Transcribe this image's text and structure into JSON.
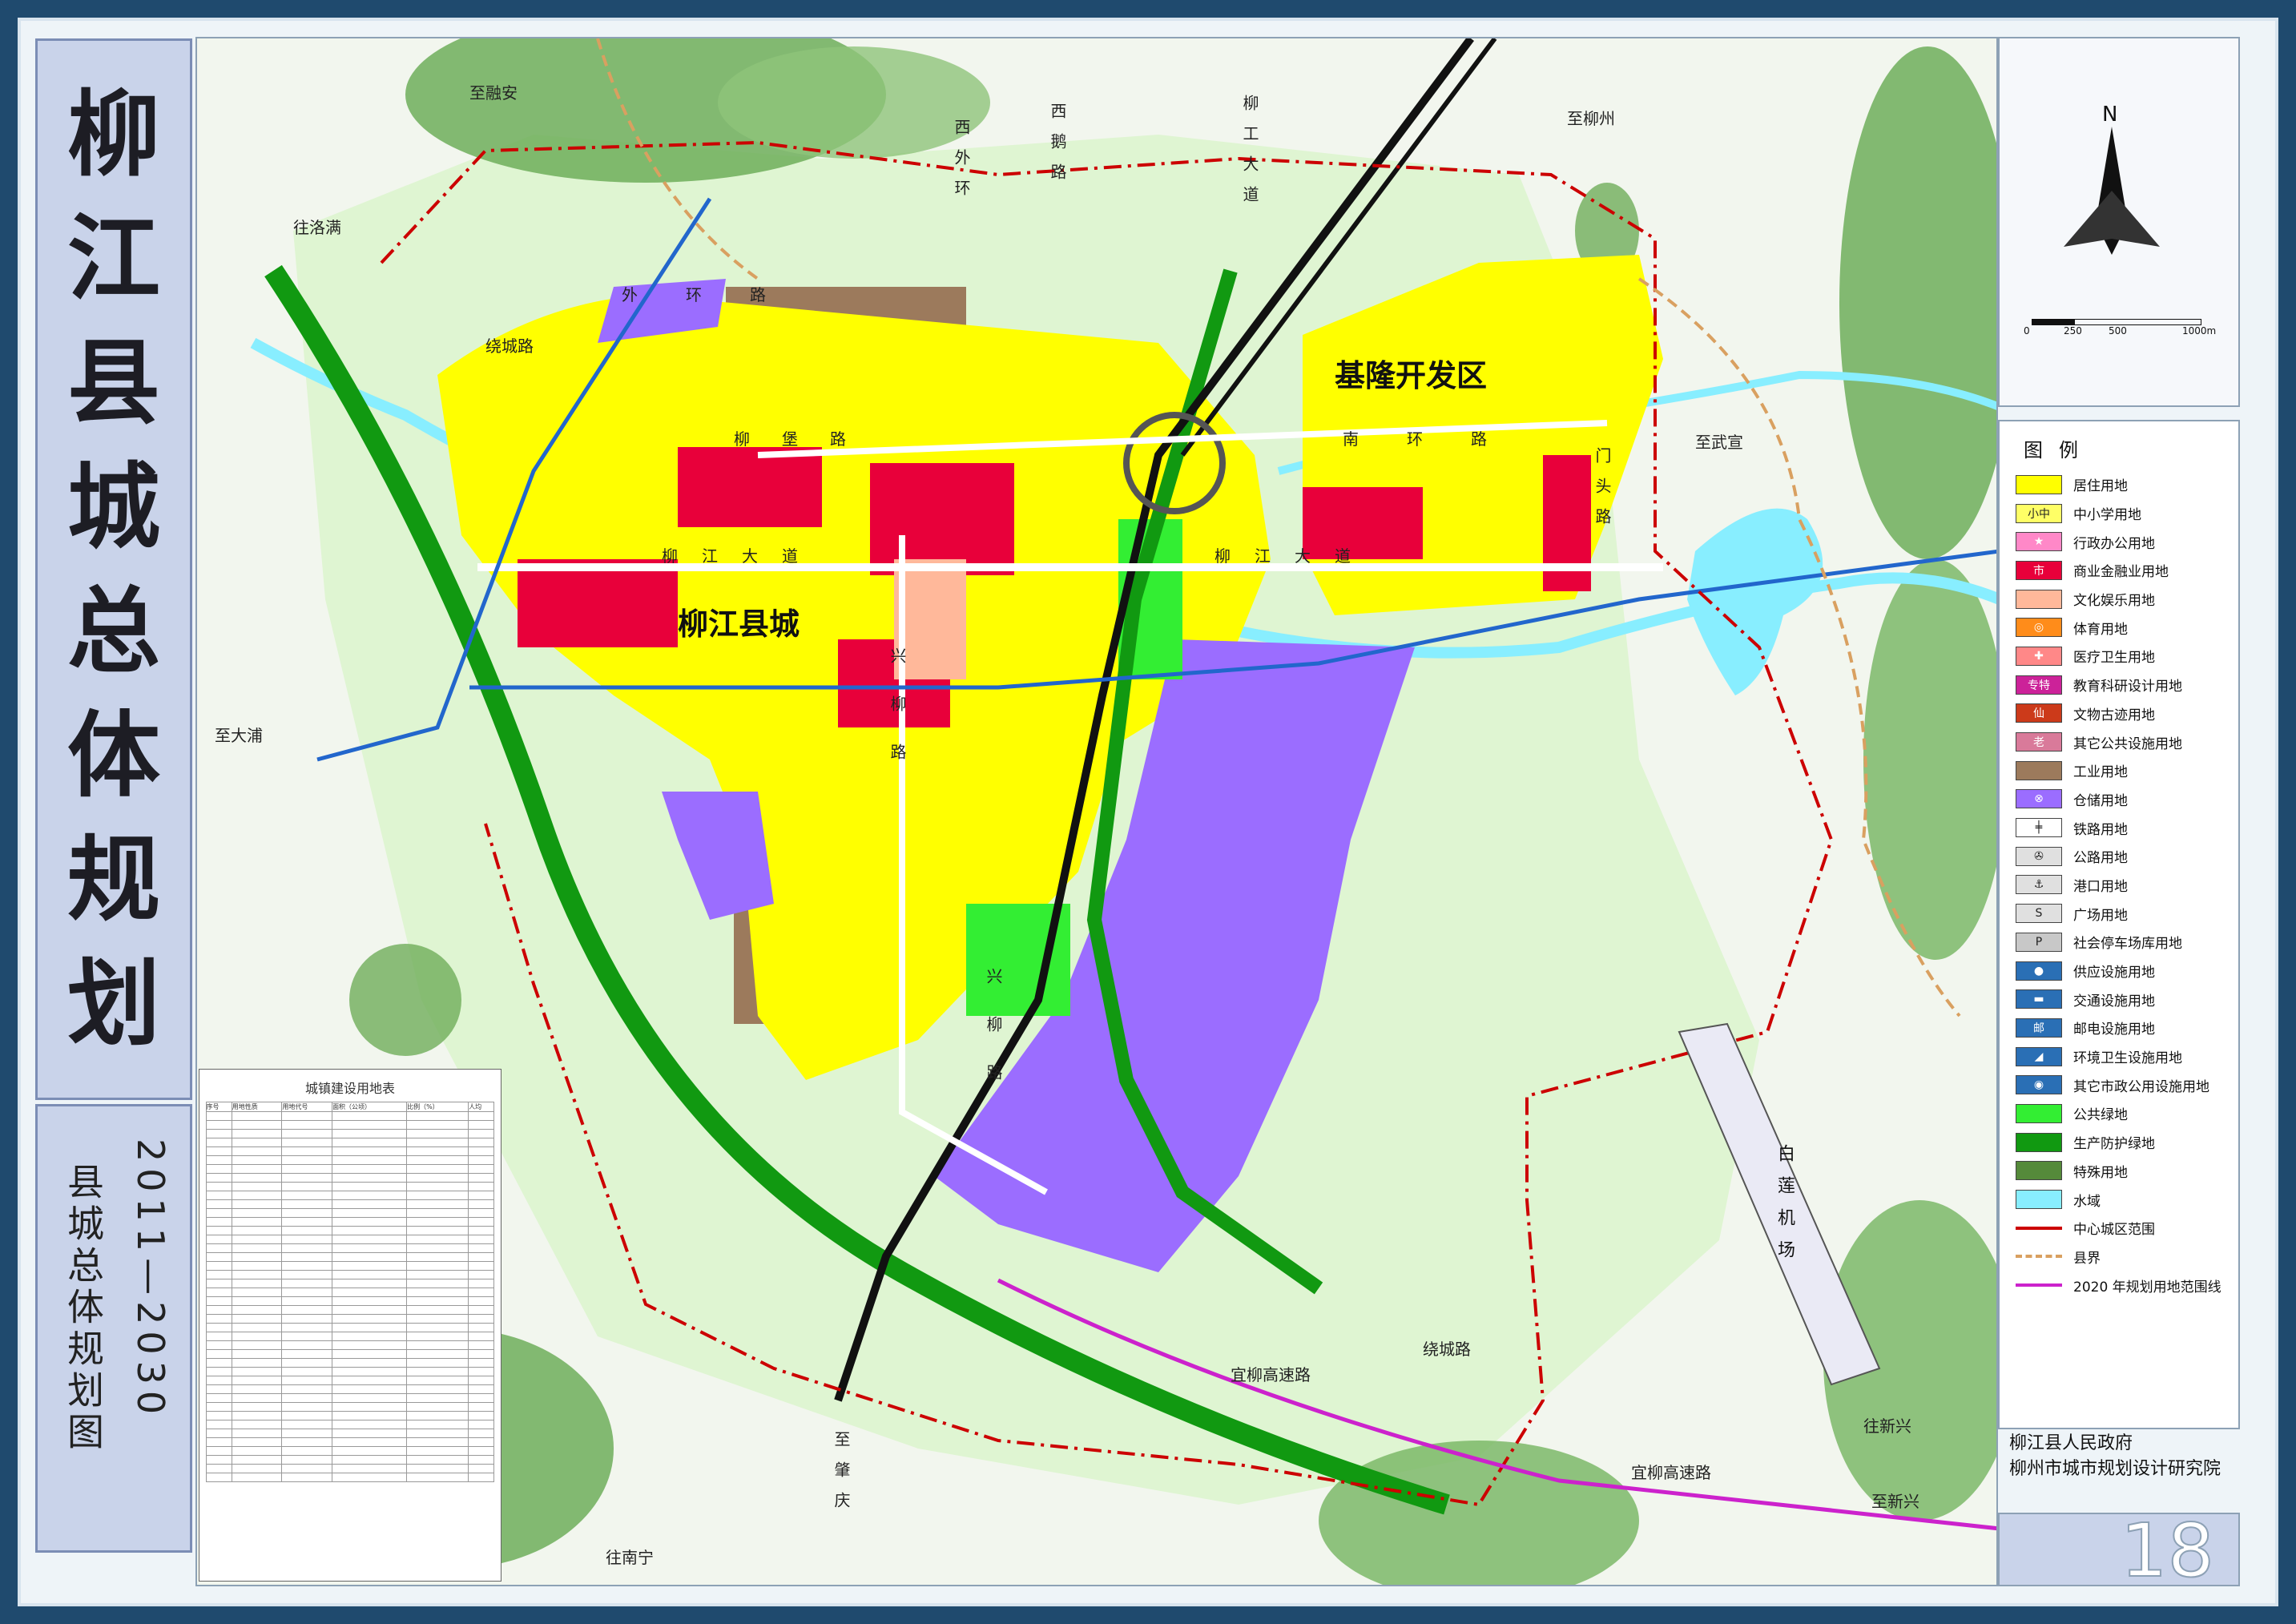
{
  "title": {
    "chars": [
      "柳",
      "江",
      "县",
      "城",
      "总",
      "体",
      "规",
      "划"
    ]
  },
  "subtitle": {
    "name": "县城总体规划图",
    "years": "2011—2030"
  },
  "map": {
    "labels": {
      "town": "柳江县城",
      "devzone": "基隆开发区",
      "airport": "白莲机场",
      "roads": {
        "xiwaihuan": "西外环",
        "xiehe": "西鹅路",
        "liugong": "柳工大道",
        "waihuan": "外环路",
        "raocheng1": "绕城路",
        "liubao": "柳堡路",
        "nanhuan": "南环路",
        "liujiang1": "柳江大道",
        "liujiang2": "柳江大道",
        "menshan": "门头路",
        "xingliu": "兴柳路",
        "xinglu2": "兴柳路",
        "yiliu1": "宜柳高速路",
        "yiliu2": "宜柳高速路",
        "raocheng2": "绕城路"
      },
      "destinations": {
        "rongan": "至融安",
        "luoman": "往洛满",
        "liuzhou": "至柳州",
        "wuxuan": "至武宣",
        "dapu": "至大浦",
        "zhaoqing": "至肇庆",
        "nanning": "往南宁",
        "xinxing1": "往新兴",
        "xinxing2": "至新兴"
      }
    }
  },
  "land_table": {
    "title": "城镇建设用地表",
    "headers": [
      "序号",
      "用地性质",
      "用地代号",
      "面积（公顷）",
      "比例（%）",
      "人均"
    ],
    "rows": []
  },
  "compass": {
    "north": "N"
  },
  "scale": {
    "ticks": [
      "0",
      "250",
      "500",
      "1000m"
    ]
  },
  "legend": {
    "title": "图例",
    "items": [
      {
        "label": "居住用地",
        "color": "#ffff00",
        "mark": ""
      },
      {
        "label": "中小学用地",
        "color": "#ffff66",
        "mark": "小中"
      },
      {
        "label": "行政办公用地",
        "color": "#ff88c8",
        "mark": "★"
      },
      {
        "label": "商业金融业用地",
        "color": "#e8003a",
        "mark": "市"
      },
      {
        "label": "文化娱乐用地",
        "color": "#ffb89a",
        "mark": ""
      },
      {
        "label": "体育用地",
        "color": "#ff8c1a",
        "mark": "◎"
      },
      {
        "label": "医疗卫生用地",
        "color": "#ff8888",
        "mark": "✚"
      },
      {
        "label": "教育科研设计用地",
        "color": "#cc2299",
        "mark": "专特"
      },
      {
        "label": "文物古迹用地",
        "color": "#cc3a1a",
        "mark": "仙"
      },
      {
        "label": "其它公共设施用地",
        "color": "#d97a9a",
        "mark": "老"
      },
      {
        "label": "工业用地",
        "color": "#9c7a5c",
        "mark": ""
      },
      {
        "label": "仓储用地",
        "color": "#9b6dff",
        "mark": "⊗"
      },
      {
        "label": "铁路用地",
        "color": "#ffffff",
        "mark": "╪"
      },
      {
        "label": "公路用地",
        "color": "#e0e0e0",
        "mark": "✇"
      },
      {
        "label": "港口用地",
        "color": "#e0e0e0",
        "mark": "⚓"
      },
      {
        "label": "广场用地",
        "color": "#e0e0e0",
        "mark": "S"
      },
      {
        "label": "社会停车场库用地",
        "color": "#c8c8c8",
        "mark": "P"
      },
      {
        "label": "供应设施用地",
        "color": "#2a6fb5",
        "mark": "●"
      },
      {
        "label": "交通设施用地",
        "color": "#2a6fb5",
        "mark": "▬"
      },
      {
        "label": "邮电设施用地",
        "color": "#2a6fb5",
        "mark": "邮"
      },
      {
        "label": "环境卫生设施用地",
        "color": "#2a6fb5",
        "mark": "◢"
      },
      {
        "label": "其它市政公用设施用地",
        "color": "#2a6fb5",
        "mark": "◉"
      },
      {
        "label": "公共绿地",
        "color": "#33ee33",
        "mark": ""
      },
      {
        "label": "生产防护绿地",
        "color": "#119911",
        "mark": ""
      },
      {
        "label": "特殊用地",
        "color": "#558a3a",
        "mark": ""
      },
      {
        "label": "水域",
        "color": "#88eeff",
        "mark": ""
      },
      {
        "label": "中心城区范围",
        "color": "#cc0000",
        "mark": "line-red"
      },
      {
        "label": "县界",
        "color": "#d9a060",
        "mark": "line-dash"
      },
      {
        "label": "2020 年规划用地范围线",
        "color": "#cc22cc",
        "mark": "line-magenta"
      }
    ]
  },
  "org": {
    "line1": "柳江县人民政府",
    "line2": "柳州市城市规划设计研究院"
  },
  "page_number": "18"
}
